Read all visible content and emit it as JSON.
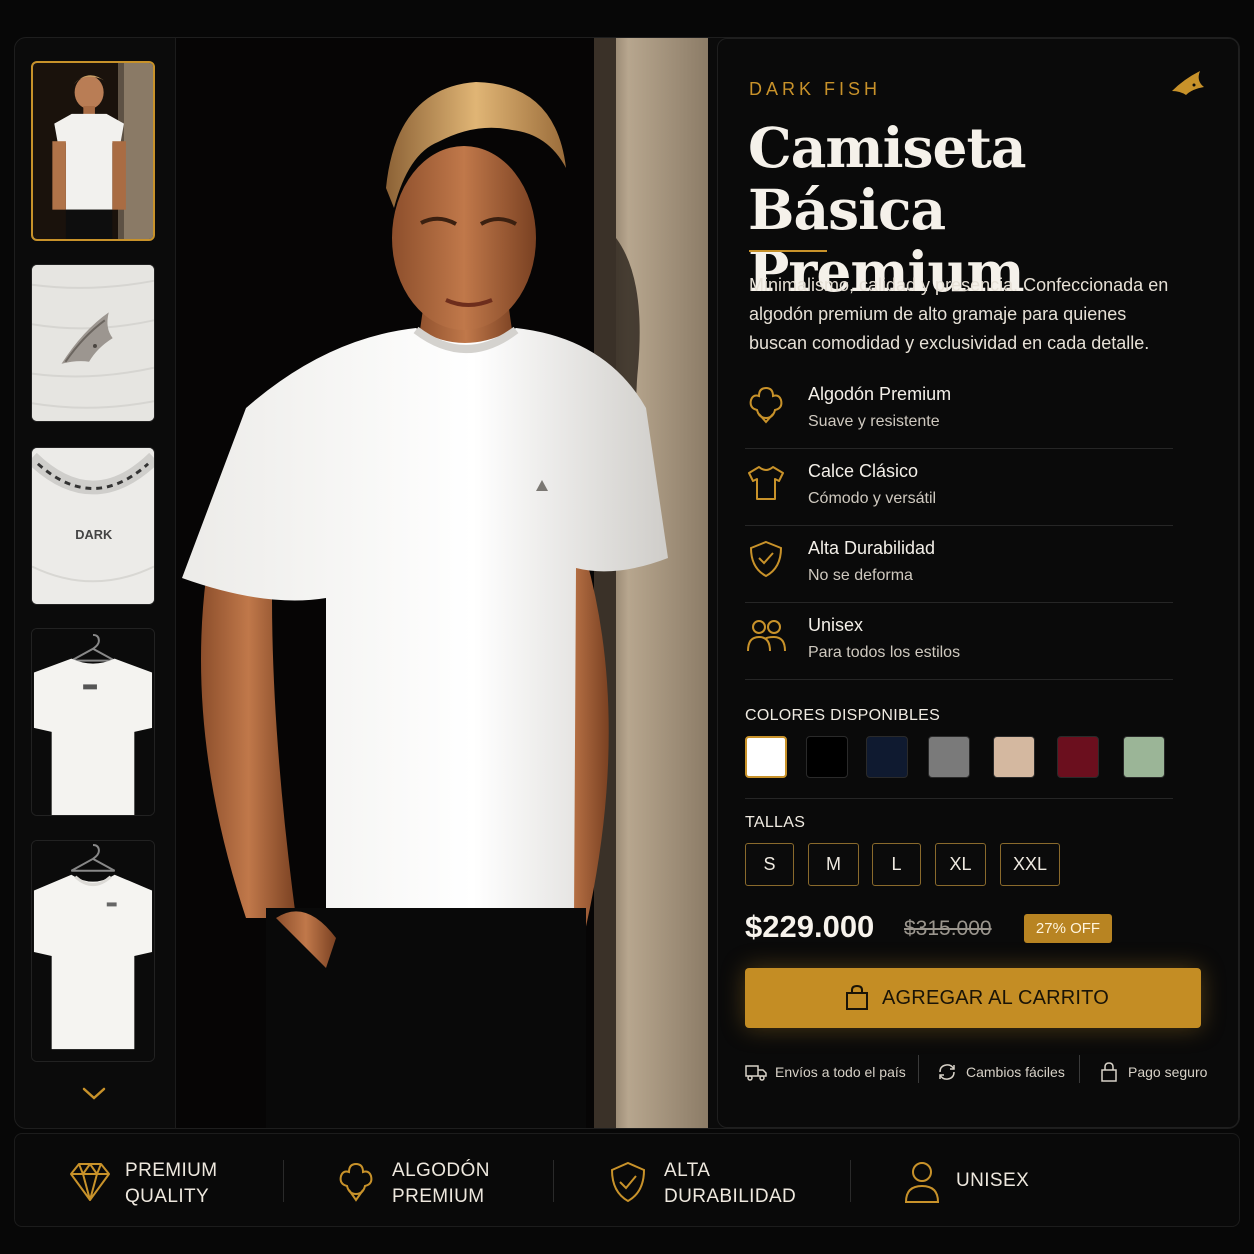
{
  "brand": "DARK FISH",
  "product": {
    "title_line1": "Camiseta Básica",
    "title_line2": "Premium",
    "description": "Minimalismo, calidad y presencia. Confeccionada en algodón premium de alto gramaje para quienes buscan comodidad y exclusividad en cada detalle."
  },
  "features": [
    {
      "icon": "cotton-icon",
      "title": "Algodón Premium",
      "subtitle": "Suave y resistente"
    },
    {
      "icon": "tshirt-icon",
      "title": "Calce Clásico",
      "subtitle": "Cómodo y versátil"
    },
    {
      "icon": "shield-check-icon",
      "title": "Alta Durabilidad",
      "subtitle": "No se deforma"
    },
    {
      "icon": "people-icon",
      "title": "Unisex",
      "subtitle": "Para todos los estilos"
    }
  ],
  "colors": {
    "label": "COLORES DISPONIBLES",
    "options": [
      "#ffffff",
      "#000000",
      "#0f1a30",
      "#7a7a7a",
      "#d4b8a0",
      "#6b0f1e",
      "#9bb597"
    ],
    "selected_index": 0
  },
  "sizes": {
    "label": "TALLAS",
    "options": [
      "S",
      "M",
      "L",
      "XL",
      "XXL"
    ]
  },
  "pricing": {
    "price": "$229.000",
    "old_price": "$315.000",
    "discount": "27% OFF"
  },
  "cta": {
    "label": "AGREGAR AL CARRITO",
    "icon": "shopping-bag-icon"
  },
  "trust": [
    {
      "icon": "truck-icon",
      "label": "Envíos a todo el país"
    },
    {
      "icon": "refresh-icon",
      "label": "Cambios fáciles"
    },
    {
      "icon": "lock-icon",
      "label": "Pago seguro"
    }
  ],
  "badges": [
    {
      "icon": "diamond-icon",
      "line1": "PREMIUM",
      "line2": "QUALITY"
    },
    {
      "icon": "cotton-icon",
      "line1": "ALGODÓN",
      "line2": "PREMIUM"
    },
    {
      "icon": "shield-check-icon",
      "line1": "ALTA",
      "line2": "DURABILIDAD"
    },
    {
      "icon": "person-icon",
      "line1": "UNISEX",
      "line2": ""
    }
  ],
  "thumbnails": [
    "model-front",
    "logo-detail",
    "collar-label",
    "back-hanger",
    "front-hanger"
  ],
  "thumb_label": "DARK",
  "accent": "#c8922a"
}
